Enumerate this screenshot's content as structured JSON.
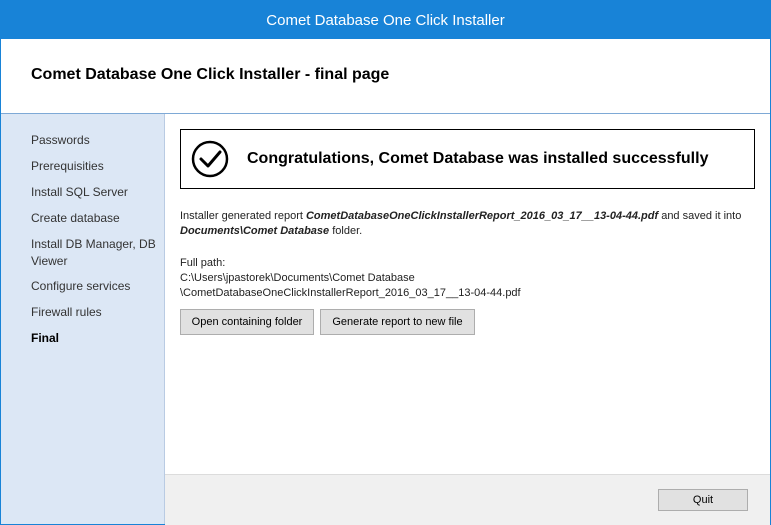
{
  "window": {
    "title": "Comet Database One Click Installer"
  },
  "header": {
    "title": "Comet Database One Click Installer - final page"
  },
  "sidebar": {
    "items": [
      {
        "label": "Passwords"
      },
      {
        "label": "Prerequisities"
      },
      {
        "label": "Install SQL Server"
      },
      {
        "label": "Create database"
      },
      {
        "label": "Install DB Manager, DB Viewer"
      },
      {
        "label": "Configure services"
      },
      {
        "label": "Firewall rules"
      },
      {
        "label": "Final",
        "active": true
      }
    ]
  },
  "main": {
    "success_message": "Congratulations, Comet Database was installed successfully",
    "success_icon": "check-circle-icon",
    "report_prefix": "Installer generated report ",
    "report_filename": "CometDatabaseOneClickInstallerReport_2016_03_17__13-04-44.pdf",
    "report_middle": " and saved it into ",
    "report_folder": "Documents\\Comet Database",
    "report_suffix": " folder.",
    "full_path_label": "Full path:",
    "full_path_line1": "C:\\Users\\jpastorek\\Documents\\Comet Database",
    "full_path_line2": "\\CometDatabaseOneClickInstallerReport_2016_03_17__13-04-44.pdf",
    "open_folder_button": "Open containing folder",
    "generate_report_button": "Generate report to new file"
  },
  "footer": {
    "quit_button": "Quit"
  },
  "colors": {
    "titlebar": "#1883d7",
    "sidebar": "#dce7f5",
    "footer": "#f0f0f0"
  }
}
